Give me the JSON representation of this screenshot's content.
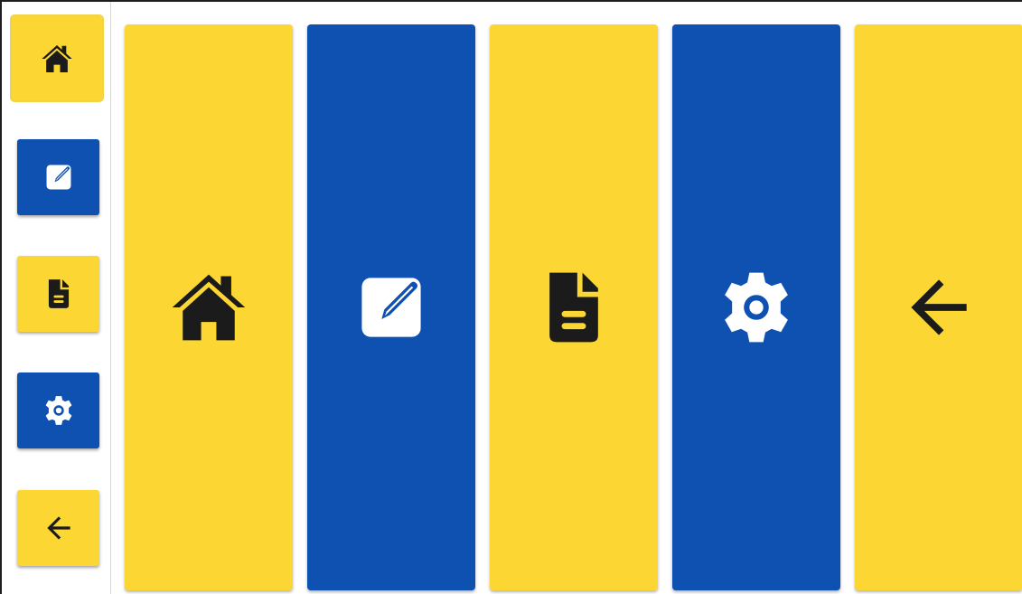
{
  "colors": {
    "yellow": "#fcd733",
    "blue": "#0f51b1",
    "icon_dark": "#1b1b1b",
    "icon_light": "#ffffff"
  },
  "sidebar": {
    "items": [
      {
        "name": "home",
        "icon": "home-icon",
        "color": "yellow",
        "active": true
      },
      {
        "name": "edit",
        "icon": "edit-icon",
        "color": "blue",
        "active": false
      },
      {
        "name": "document",
        "icon": "document-icon",
        "color": "yellow",
        "active": false
      },
      {
        "name": "settings",
        "icon": "gear-icon",
        "color": "blue",
        "active": false
      },
      {
        "name": "back",
        "icon": "arrow-left-icon",
        "color": "yellow",
        "active": false
      }
    ]
  },
  "tiles": [
    {
      "name": "home",
      "icon": "home-icon",
      "color": "yellow"
    },
    {
      "name": "edit",
      "icon": "edit-icon",
      "color": "blue"
    },
    {
      "name": "document",
      "icon": "document-icon",
      "color": "yellow"
    },
    {
      "name": "settings",
      "icon": "gear-icon",
      "color": "blue"
    },
    {
      "name": "back",
      "icon": "arrow-left-icon",
      "color": "yellow"
    }
  ]
}
